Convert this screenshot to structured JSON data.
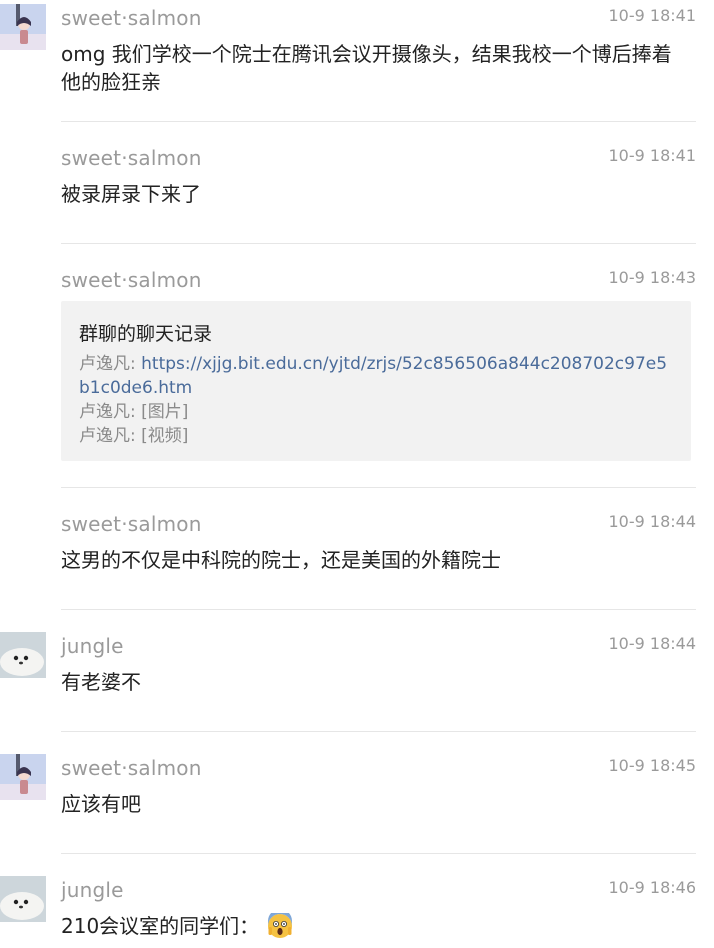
{
  "messages": [
    {
      "sender": "sweet·salmon",
      "time": "10-9 18:41",
      "avatar": "anime-girl-avatar",
      "text": "omg 我们学校一个院士在腾讯会议开摄像头，结果我校一个博后捧着他的脸狂亲"
    },
    {
      "sender": "sweet·salmon",
      "time": "10-9 18:41",
      "text": "被录屏录下来了"
    },
    {
      "sender": "sweet·salmon",
      "time": "10-9 18:43",
      "card": {
        "title": "群聊的聊天记录",
        "lines": [
          {
            "name": "卢逸凡:",
            "content": "https://xjjg.bit.edu.cn/yjtd/zrjs/52c856506a844c208702c97e5b1c0de6.htm"
          },
          {
            "name": "卢逸凡:",
            "content": "[图片]"
          },
          {
            "name": "卢逸凡:",
            "content": "[视频]"
          }
        ]
      }
    },
    {
      "sender": "sweet·salmon",
      "time": "10-9 18:44",
      "text": "这男的不仅是中科院的院士，还是美国的外籍院士"
    },
    {
      "sender": "jungle",
      "time": "10-9 18:44",
      "avatar": "baby-seal-avatar",
      "text": "有老婆不"
    },
    {
      "sender": "sweet·salmon",
      "time": "10-9 18:45",
      "avatar": "anime-girl-avatar",
      "text": "应该有吧"
    },
    {
      "sender": "jungle",
      "time": "10-9 18:46",
      "avatar": "baby-seal-avatar",
      "text": "210会议室的同学们：",
      "emoji": "screaming-face-emoji"
    }
  ]
}
